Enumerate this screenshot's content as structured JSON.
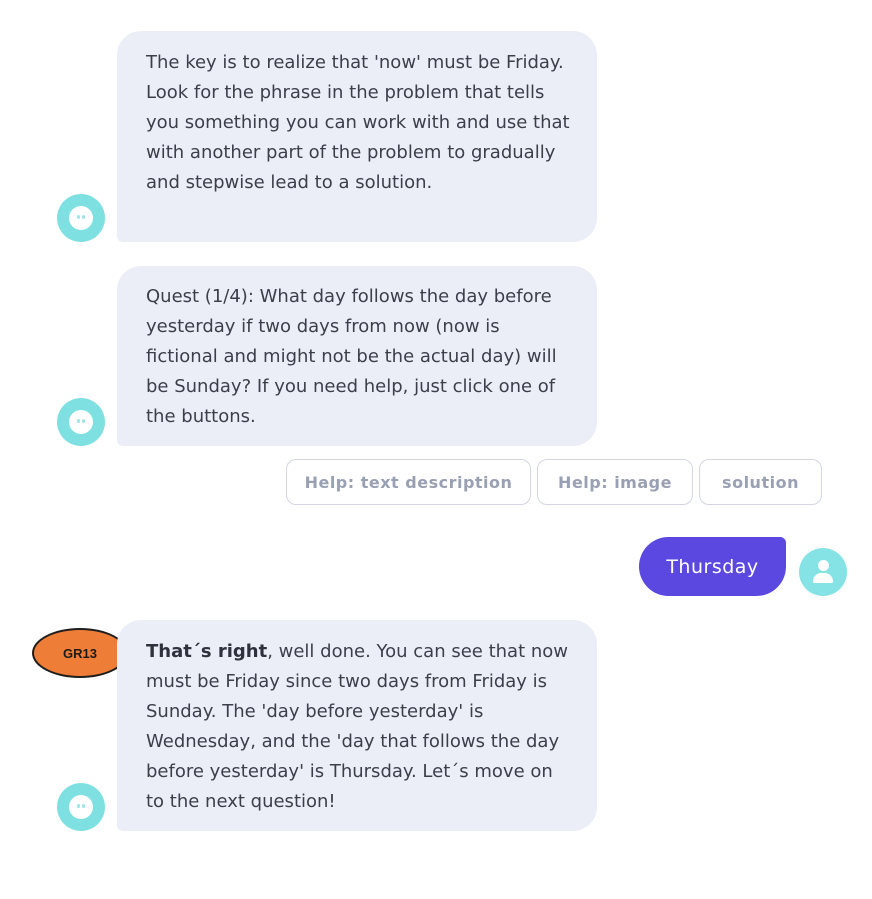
{
  "messages": {
    "hint": {
      "text": "The key is to realize that 'now' must be Friday. Look for the phrase in the problem that tells you something you can work with and use that with another part of the problem to gradually and stepwise lead to a solution."
    },
    "quest": {
      "text": "Quest (1/4): What day follows the day before yesterday if two days from now (now is fictional and might not be the actual day) will be Sunday? If you need help, just click one of the buttons."
    },
    "feedback": {
      "bold": "That´s right",
      "text": ", well done. You can see that now must be Friday since two days from Friday is Sunday. The 'day before yesterday' is Wednesday, and the 'day that follows the day before yesterday' is Thursday. Let´s move on to the next question!"
    }
  },
  "help_buttons": {
    "text_description": "Help: text description",
    "image": "Help: image",
    "solution": "solution"
  },
  "user_reply": {
    "text": "Thursday"
  },
  "badge": {
    "label": "GR13"
  },
  "colors": {
    "bot_bubble": "#eceef7",
    "user_bubble": "#5b48e0",
    "avatar": "#7fe0e2",
    "badge": "#ee7d37"
  },
  "icons": {
    "bot_avatar": "bot-face-icon",
    "user_avatar": "user-icon"
  }
}
